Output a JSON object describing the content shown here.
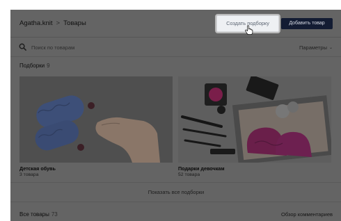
{
  "header": {
    "shop_name": "Agatha.knit",
    "separator": ">",
    "section": "Товары",
    "create_button": "Создать подборку",
    "add_button": "Добавить товар"
  },
  "search": {
    "placeholder": "Поиск по товарам",
    "params_label": "Параметры",
    "params_chevron": "⌄"
  },
  "collections": {
    "title": "Подборки",
    "count": "9",
    "items": [
      {
        "title": "Детская обувь",
        "subtitle": "3 товара",
        "image": "knitted-baby-booties-photo"
      },
      {
        "title": "Подарки девочкам",
        "subtitle": "52 товара",
        "image": "cosmetics-and-pink-slippers-photo"
      }
    ],
    "show_all": "Показать все подборки"
  },
  "all_products": {
    "title": "Все товары",
    "count": "73",
    "overview_link": "Обзор комментариев"
  },
  "colors": {
    "overlay_bg": "#646464",
    "primary_button": "#131c33",
    "highlight_button": "#eef0f3"
  }
}
